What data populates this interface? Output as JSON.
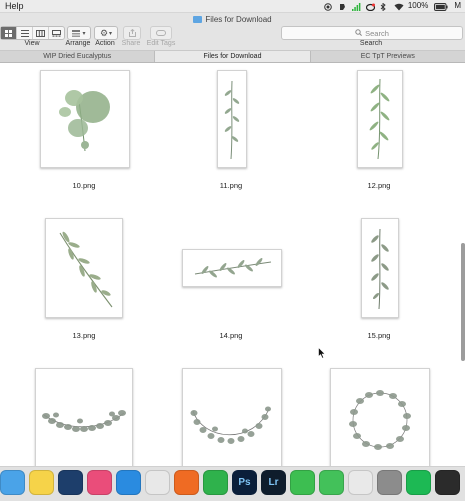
{
  "menubar": {
    "app_menu": "Help",
    "battery": "100%",
    "trailing": "M"
  },
  "window": {
    "title": "Files for Download"
  },
  "toolbar": {
    "view_label": "View",
    "arrange_label": "Arrange",
    "action_label": "Action",
    "share_label": "Share",
    "edit_tags_label": "Edit Tags",
    "search_placeholder": "Search",
    "search_label": "Search"
  },
  "tabs": [
    {
      "label": "WIP Dried Eucalyptus",
      "active": false
    },
    {
      "label": "Files for Download",
      "active": true
    },
    {
      "label": "EC TpT Previews",
      "active": false
    }
  ],
  "files": [
    {
      "name": "10.png",
      "art": "round-leaves"
    },
    {
      "name": "11.png",
      "art": "vertical-sprig"
    },
    {
      "name": "12.png",
      "art": "vertical-sprig"
    },
    {
      "name": "13.png",
      "art": "diagonal-branch"
    },
    {
      "name": "14.png",
      "art": "horizontal-sprig"
    },
    {
      "name": "15.png",
      "art": "vertical-sprig"
    },
    {
      "name": "",
      "art": "eucalyptus-swag"
    },
    {
      "name": "",
      "art": "eucalyptus-arc"
    },
    {
      "name": "",
      "art": "eucalyptus-wreath"
    }
  ],
  "dock": {
    "apps": [
      {
        "name": "finder",
        "icon": "finder-icon",
        "color": "#4aa3e8"
      },
      {
        "name": "notes",
        "icon": "notes-icon",
        "color": "#f6d349"
      },
      {
        "name": "quicktime",
        "icon": "quicktime-icon",
        "color": "#1d3e6b"
      },
      {
        "name": "itunes",
        "icon": "itunes-icon",
        "color": "#ea4d7a"
      },
      {
        "name": "safari",
        "icon": "safari-icon",
        "color": "#2a8be0"
      },
      {
        "name": "chrome",
        "icon": "chrome-icon",
        "color": "#e8e8e8"
      },
      {
        "name": "firefox",
        "icon": "firefox-icon",
        "color": "#ef6b23"
      },
      {
        "name": "evernote",
        "icon": "evernote-icon",
        "color": "#2fb24c"
      },
      {
        "name": "photoshop",
        "icon": "photoshop-icon",
        "color": "#0b1f3a",
        "text": "Ps"
      },
      {
        "name": "lightroom",
        "icon": "lightroom-icon",
        "color": "#0f1d2c",
        "text": "Lr"
      },
      {
        "name": "facetime",
        "icon": "facetime-icon",
        "color": "#3dbe51"
      },
      {
        "name": "messages",
        "icon": "messages-icon",
        "color": "#43c15a"
      },
      {
        "name": "numbers",
        "icon": "numbers-icon",
        "color": "#e9e9e9"
      },
      {
        "name": "system-preferences",
        "icon": "gear-icon",
        "color": "#8c8c8c"
      },
      {
        "name": "spotify",
        "icon": "spotify-icon",
        "color": "#1db954"
      },
      {
        "name": "terminal",
        "icon": "terminal-icon",
        "color": "#2b2b2b"
      }
    ]
  }
}
